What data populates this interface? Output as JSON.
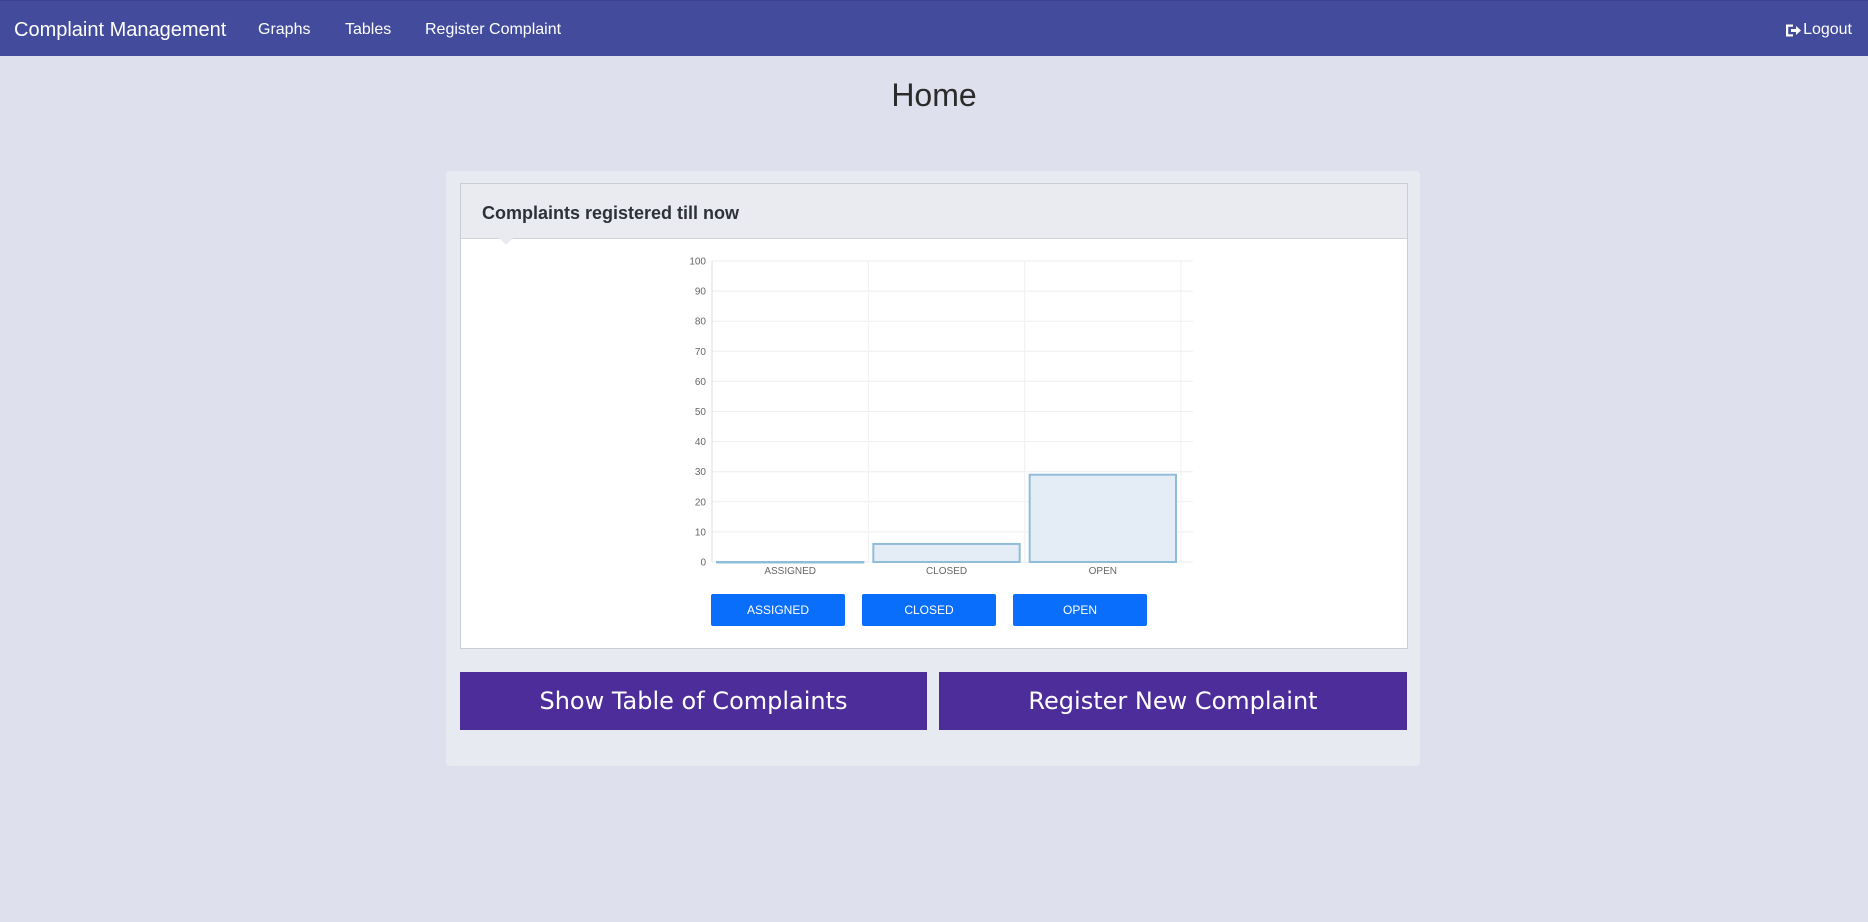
{
  "navbar": {
    "brand": "Complaint Management",
    "links": [
      "Graphs",
      "Tables",
      "Register Complaint"
    ],
    "logout": "Logout",
    "logout_icon": "sign-out-icon"
  },
  "page": {
    "title": "Home"
  },
  "panel": {
    "title": "Complaints registered till now"
  },
  "chart_data": {
    "type": "bar",
    "categories": [
      "ASSIGNED",
      "CLOSED",
      "OPEN"
    ],
    "values": [
      0,
      6,
      29
    ],
    "ylim": [
      0,
      100
    ],
    "yticks": [
      0,
      10,
      20,
      30,
      40,
      50,
      60,
      70,
      80,
      90,
      100
    ],
    "grid": true,
    "legend": "bottom",
    "legend_labels": [
      "ASSIGNED",
      "CLOSED",
      "OPEN"
    ],
    "bar_fill": "#e4edf6",
    "bar_stroke": "#8fbcd9"
  },
  "actions": {
    "show_table": "Show Table of Complaints",
    "register_new": "Register New Complaint"
  },
  "colors": {
    "navbar": "#424b9c",
    "background": "#dfe0ee",
    "chart_button": "#0a6efd",
    "action_button": "#4d2d99"
  }
}
